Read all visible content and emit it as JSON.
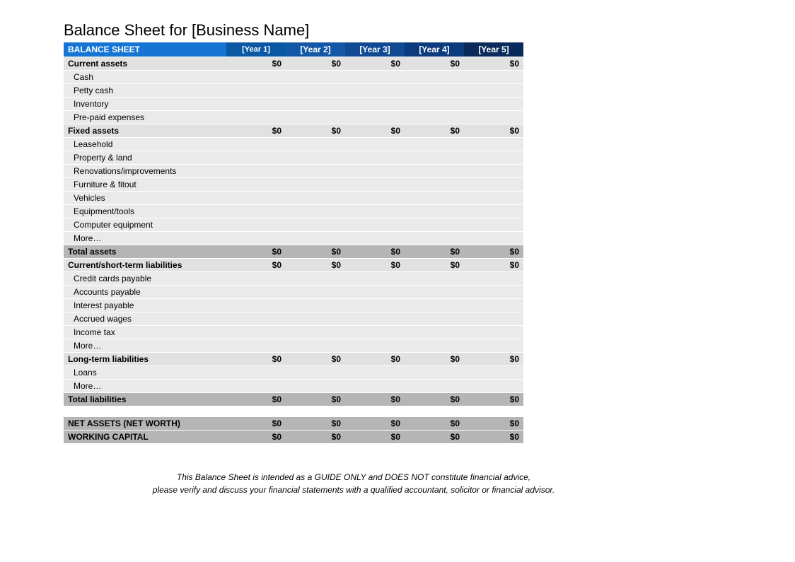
{
  "title": "Balance Sheet for [Business Name]",
  "header": {
    "main": "BALANCE SHEET",
    "years": [
      "[Year 1]",
      "[Year 2]",
      "[Year 3]",
      "[Year 4]",
      "[Year 5]"
    ]
  },
  "sections": [
    {
      "label": "Current assets",
      "type": "subtotal",
      "values": [
        "$0",
        "$0",
        "$0",
        "$0",
        "$0"
      ]
    },
    {
      "label": "Cash",
      "type": "item",
      "values": [
        "",
        "",
        "",
        "",
        ""
      ]
    },
    {
      "label": "Petty cash",
      "type": "item",
      "values": [
        "",
        "",
        "",
        "",
        ""
      ]
    },
    {
      "label": "Inventory",
      "type": "item",
      "values": [
        "",
        "",
        "",
        "",
        ""
      ]
    },
    {
      "label": "Pre-paid expenses",
      "type": "item",
      "values": [
        "",
        "",
        "",
        "",
        ""
      ]
    },
    {
      "label": "Fixed assets",
      "type": "subtotal",
      "values": [
        "$0",
        "$0",
        "$0",
        "$0",
        "$0"
      ]
    },
    {
      "label": "Leasehold",
      "type": "item",
      "values": [
        "",
        "",
        "",
        "",
        ""
      ]
    },
    {
      "label": "Property & land",
      "type": "item",
      "values": [
        "",
        "",
        "",
        "",
        ""
      ]
    },
    {
      "label": "Renovations/improvements",
      "type": "item",
      "values": [
        "",
        "",
        "",
        "",
        ""
      ]
    },
    {
      "label": "Furniture & fitout",
      "type": "item",
      "values": [
        "",
        "",
        "",
        "",
        ""
      ]
    },
    {
      "label": "Vehicles",
      "type": "item",
      "values": [
        "",
        "",
        "",
        "",
        ""
      ]
    },
    {
      "label": "Equipment/tools",
      "type": "item",
      "values": [
        "",
        "",
        "",
        "",
        ""
      ]
    },
    {
      "label": "Computer equipment",
      "type": "item",
      "values": [
        "",
        "",
        "",
        "",
        ""
      ]
    },
    {
      "label": "More…",
      "type": "item",
      "values": [
        "",
        "",
        "",
        "",
        ""
      ]
    },
    {
      "label": "Total assets",
      "type": "total",
      "values": [
        "$0",
        "$0",
        "$0",
        "$0",
        "$0"
      ]
    },
    {
      "label": "Current/short-term liabilities",
      "type": "subtotal",
      "values": [
        "$0",
        "$0",
        "$0",
        "$0",
        "$0"
      ]
    },
    {
      "label": "Credit cards payable",
      "type": "item",
      "values": [
        "",
        "",
        "",
        "",
        ""
      ]
    },
    {
      "label": "Accounts payable",
      "type": "item",
      "values": [
        "",
        "",
        "",
        "",
        ""
      ]
    },
    {
      "label": "Interest payable",
      "type": "item",
      "values": [
        "",
        "",
        "",
        "",
        ""
      ]
    },
    {
      "label": "Accrued wages",
      "type": "item",
      "values": [
        "",
        "",
        "",
        "",
        ""
      ]
    },
    {
      "label": "Income tax",
      "type": "item",
      "values": [
        "",
        "",
        "",
        "",
        ""
      ]
    },
    {
      "label": "More…",
      "type": "item",
      "values": [
        "",
        "",
        "",
        "",
        ""
      ]
    },
    {
      "label": "Long-term liabilities",
      "type": "subtotal",
      "values": [
        "$0",
        "$0",
        "$0",
        "$0",
        "$0"
      ]
    },
    {
      "label": "Loans",
      "type": "item",
      "values": [
        "",
        "",
        "",
        "",
        ""
      ]
    },
    {
      "label": "More…",
      "type": "item",
      "values": [
        "",
        "",
        "",
        "",
        ""
      ]
    },
    {
      "label": "Total liabilities",
      "type": "total",
      "values": [
        "$0",
        "$0",
        "$0",
        "$0",
        "$0"
      ]
    },
    {
      "label": "",
      "type": "spacer",
      "values": [
        "",
        "",
        "",
        "",
        ""
      ]
    },
    {
      "label": "NET ASSETS (NET WORTH)",
      "type": "total",
      "values": [
        "$0",
        "$0",
        "$0",
        "$0",
        "$0"
      ]
    },
    {
      "label": "WORKING CAPITAL",
      "type": "total",
      "values": [
        "$0",
        "$0",
        "$0",
        "$0",
        "$0"
      ]
    }
  ],
  "disclaimer": {
    "line1": "This Balance Sheet is intended as a GUIDE ONLY and DOES NOT constitute financial advice,",
    "line2": "please verify and discuss your financial statements with a qualified accountant, solicitor or financial advisor."
  }
}
